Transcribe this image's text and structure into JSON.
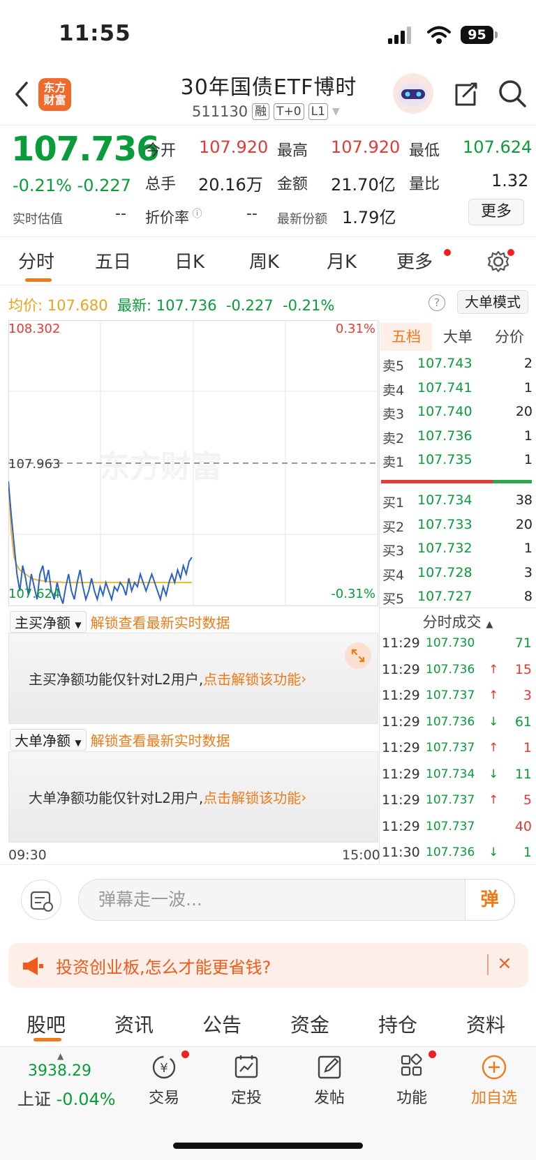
{
  "status_bar": {
    "time": "11:55",
    "battery": "95"
  },
  "header": {
    "app_logo": "东方\n财富",
    "title": "30年国债ETF博时",
    "code": "511130",
    "tags": [
      "融",
      "T+0",
      "L1"
    ]
  },
  "quote": {
    "price": "107.736",
    "change_pct": "-0.21%",
    "change_abs": "-0.227",
    "est_label": "实时估值",
    "est_value": "--",
    "fields": [
      {
        "label": "今开",
        "value": "107.920"
      },
      {
        "label": "最高",
        "value": "107.920"
      },
      {
        "label": "最低",
        "value": "107.624"
      },
      {
        "label": "总手",
        "value": "20.16万"
      },
      {
        "label": "金额",
        "value": "21.70亿"
      },
      {
        "label": "量比",
        "value": "1.32"
      },
      {
        "label": "折价率",
        "value": "--"
      },
      {
        "label": "最新份额",
        "value": "1.79亿"
      }
    ],
    "more": "更多"
  },
  "chart_tabs": [
    "分时",
    "五日",
    "日K",
    "周K",
    "月K",
    "更多"
  ],
  "info_line": {
    "avg_label": "均价:",
    "avg_value": "107.680",
    "latest_label": "最新:",
    "latest_value": "107.736",
    "change": "-0.227",
    "change_pct": "-0.21%",
    "help": "?",
    "big_order_mode": "大单模式"
  },
  "chart_data": {
    "type": "line",
    "y_top": "108.302",
    "y_mid": "107.963",
    "y_bottom": "107.624",
    "pct_top": "0.31%",
    "pct_bottom": "-0.31%",
    "ylim": [
      107.624,
      108.302
    ],
    "x_start": "09:30",
    "x_end": "15:00",
    "watermark": "东方财富",
    "series": [
      {
        "color": "#2a62c4",
        "values": [
          107.92,
          107.84,
          107.77,
          107.7,
          107.66,
          107.72,
          107.69,
          107.65,
          107.7,
          107.67,
          107.64,
          107.7,
          107.72,
          107.68,
          107.71,
          107.66,
          107.64,
          107.68,
          107.65,
          107.63,
          107.67,
          107.7,
          107.66,
          107.64,
          107.68,
          107.71,
          107.67,
          107.64,
          107.66,
          107.69,
          107.66,
          107.64,
          107.67,
          107.65,
          107.68,
          107.66,
          107.64,
          107.67,
          107.66,
          107.68,
          107.67,
          107.65,
          107.69,
          107.66,
          107.68,
          107.67,
          107.7,
          107.68,
          107.66,
          107.68,
          107.7,
          107.68,
          107.66,
          107.64,
          107.67,
          107.65,
          107.68,
          107.7,
          107.68,
          107.71,
          107.69,
          107.72,
          107.7,
          107.73,
          107.74
        ]
      },
      {
        "color": "#f2b233",
        "values": [
          107.92,
          107.8,
          107.74,
          107.72,
          107.71,
          107.705,
          107.7,
          107.695,
          107.69,
          107.688,
          107.686,
          107.685,
          107.684,
          107.683,
          107.682,
          107.682,
          107.681,
          107.681,
          107.681,
          107.68,
          107.68,
          107.68,
          107.68,
          107.68,
          107.68,
          107.68,
          107.68,
          107.68,
          107.68,
          107.68,
          107.68,
          107.68,
          107.68,
          107.68,
          107.68,
          107.68,
          107.68,
          107.68,
          107.68,
          107.68,
          107.68,
          107.68,
          107.68,
          107.68,
          107.68,
          107.68,
          107.68,
          107.68,
          107.68,
          107.68,
          107.68,
          107.68,
          107.68,
          107.68,
          107.68,
          107.68,
          107.68,
          107.68,
          107.68,
          107.68,
          107.68,
          107.68,
          107.68,
          107.68,
          107.68
        ]
      }
    ]
  },
  "order_book": {
    "tabs": [
      "五档",
      "大单",
      "分价"
    ],
    "sells": [
      {
        "label": "卖5",
        "price": "107.743",
        "vol": "2"
      },
      {
        "label": "卖4",
        "price": "107.741",
        "vol": "1"
      },
      {
        "label": "卖3",
        "price": "107.740",
        "vol": "20"
      },
      {
        "label": "卖2",
        "price": "107.736",
        "vol": "1"
      },
      {
        "label": "卖1",
        "price": "107.735",
        "vol": "1"
      }
    ],
    "buys": [
      {
        "label": "买1",
        "price": "107.734",
        "vol": "38"
      },
      {
        "label": "买2",
        "price": "107.733",
        "vol": "20"
      },
      {
        "label": "买3",
        "price": "107.732",
        "vol": "1"
      },
      {
        "label": "买4",
        "price": "107.728",
        "vol": "3"
      },
      {
        "label": "买5",
        "price": "107.727",
        "vol": "8"
      }
    ]
  },
  "ticks": {
    "title": "分时成交",
    "rows": [
      {
        "time": "11:29",
        "price": "107.730",
        "arrow": "",
        "vol": "71",
        "color": "green"
      },
      {
        "time": "11:29",
        "price": "107.736",
        "arrow": "↑",
        "vol": "15",
        "color": "red"
      },
      {
        "time": "11:29",
        "price": "107.737",
        "arrow": "↑",
        "vol": "3",
        "color": "red"
      },
      {
        "time": "11:29",
        "price": "107.736",
        "arrow": "↓",
        "vol": "61",
        "color": "green"
      },
      {
        "time": "11:29",
        "price": "107.737",
        "arrow": "↑",
        "vol": "1",
        "color": "red"
      },
      {
        "time": "11:29",
        "price": "107.734",
        "arrow": "↓",
        "vol": "11",
        "color": "green"
      },
      {
        "time": "11:29",
        "price": "107.737",
        "arrow": "↑",
        "vol": "5",
        "color": "red"
      },
      {
        "time": "11:29",
        "price": "107.737",
        "arrow": "",
        "vol": "40",
        "color": "red"
      },
      {
        "time": "11:30",
        "price": "107.736",
        "arrow": "↓",
        "vol": "1",
        "color": "green"
      }
    ]
  },
  "panels": {
    "main_net": {
      "title": "主买净额",
      "unlock": "解锁查看最新实时数据",
      "text": "主买净额功能仅针对L2用户,",
      "link": "点击解锁该功能"
    },
    "big_net": {
      "title": "大单净额",
      "unlock": "解锁查看最新实时数据",
      "text": "大单净额功能仅针对L2用户,",
      "link": "点击解锁该功能"
    }
  },
  "danmaku": {
    "placeholder": "弹幕走一波...",
    "send": "弹"
  },
  "ad": {
    "text": "投资创业板,怎么才能更省钱?",
    "close": "×"
  },
  "bottom_tabs": [
    "股吧",
    "资讯",
    "公告",
    "资金",
    "持仓",
    "资料"
  ],
  "toolbar": {
    "index_value": "3938.29",
    "index_name": "上证",
    "index_change": "-0.04%",
    "items": [
      "交易",
      "定投",
      "发帖",
      "功能",
      "加自选"
    ]
  }
}
